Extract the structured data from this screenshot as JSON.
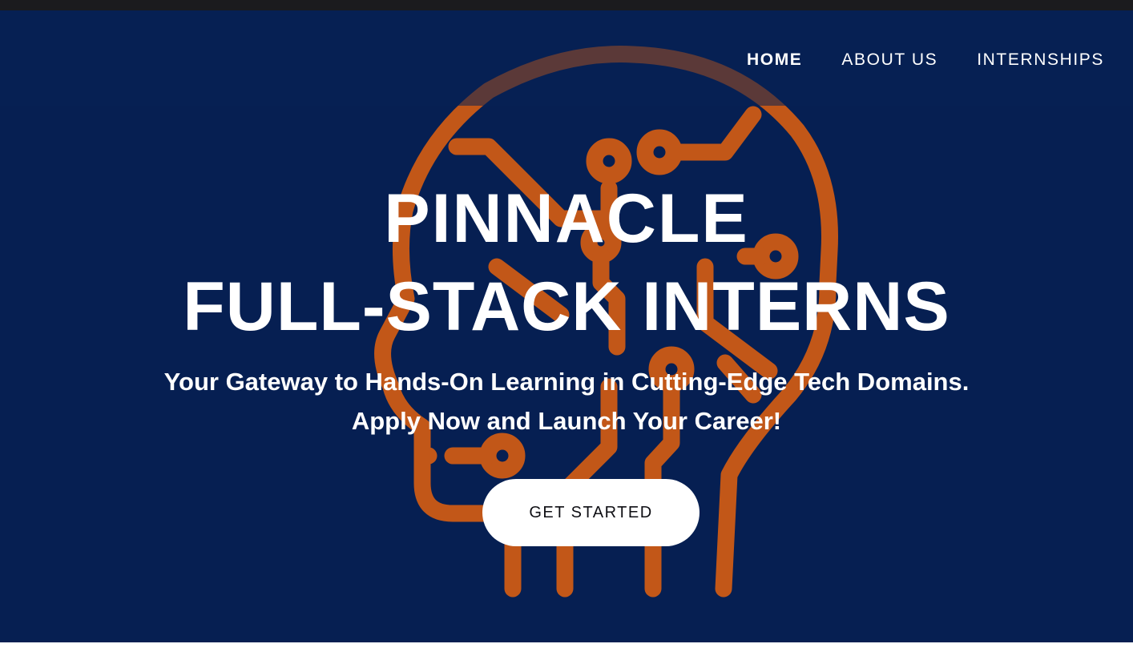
{
  "nav": {
    "items": [
      {
        "label": "HOME",
        "active": true
      },
      {
        "label": "ABOUT US",
        "active": false
      },
      {
        "label": "INTERNSHIPS",
        "active": false
      }
    ]
  },
  "hero": {
    "title_line1": "PINNACLE",
    "title_line2": "FULL-STACK INTERNS",
    "subtitle_line1": "Your Gateway to Hands-On Learning in Cutting-Edge Tech Domains.",
    "subtitle_line2": "Apply Now and Launch Your Career!",
    "cta_label": "GET STARTED",
    "illustration": "circuit-head-icon"
  },
  "colors": {
    "hero_background": "#061f52",
    "illustration_orange": "#c25718",
    "top_bar": "#1b1b1e",
    "text": "#ffffff",
    "button_background": "#ffffff",
    "button_text": "#0f0f14"
  }
}
